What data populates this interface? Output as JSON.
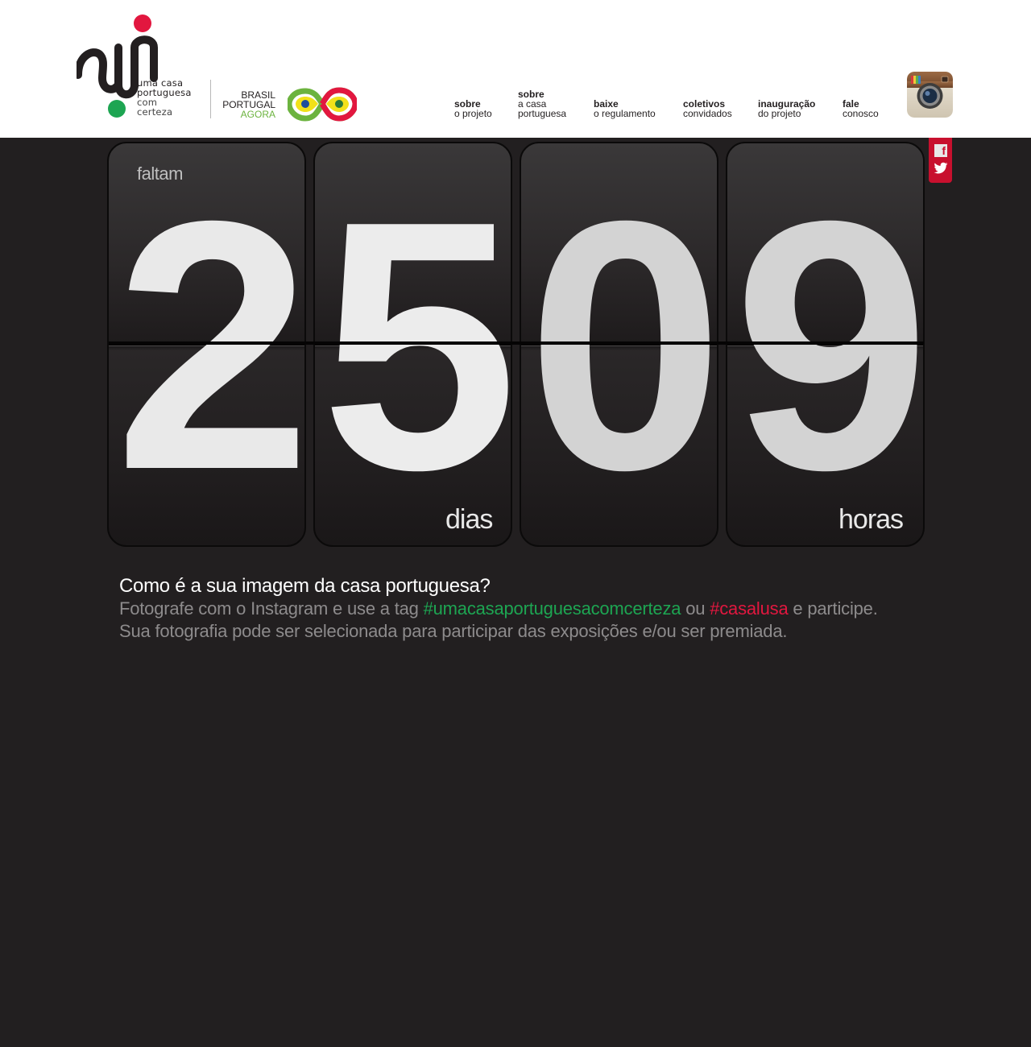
{
  "logo": {
    "lines": [
      "uma casa",
      "portuguesa",
      "com",
      "certeza"
    ],
    "partner_lines": [
      "BRASIL",
      "PORTUGAL",
      "AGORA"
    ]
  },
  "nav": [
    {
      "bold": "sobre",
      "light": "o projeto"
    },
    {
      "bold": "sobre",
      "light": "a casa",
      "light2": "portuguesa"
    },
    {
      "bold": "baixe",
      "light": "o regulamento"
    },
    {
      "bold": "coletivos",
      "light": "convidados"
    },
    {
      "bold": "inauguração",
      "light": "do projeto"
    },
    {
      "bold": "fale",
      "light": "conosco"
    }
  ],
  "counter": {
    "prefix": "faltam",
    "digits": [
      "2",
      "5",
      "0",
      "9"
    ],
    "days_label": "dias",
    "hours_label": "horas"
  },
  "info": {
    "question": "Como é a sua imagem da casa portuguesa?",
    "line1_pre": "Fotografe com o Instagram e use a tag ",
    "tag1": "#umacasaportuguesacomcerteza",
    "line1_mid": " ou ",
    "tag2": "#casalusa",
    "line1_post": " e participe.",
    "line2": "Sua fotografia pode ser selecionada para participar das exposições e/ou ser premiada."
  },
  "colors": {
    "background": "#221f20",
    "accent_red": "#e2173f",
    "accent_green": "#1da552",
    "social_tab": "#c8102e"
  },
  "icons": [
    "instagram-icon",
    "facebook-icon",
    "twitter-icon"
  ]
}
